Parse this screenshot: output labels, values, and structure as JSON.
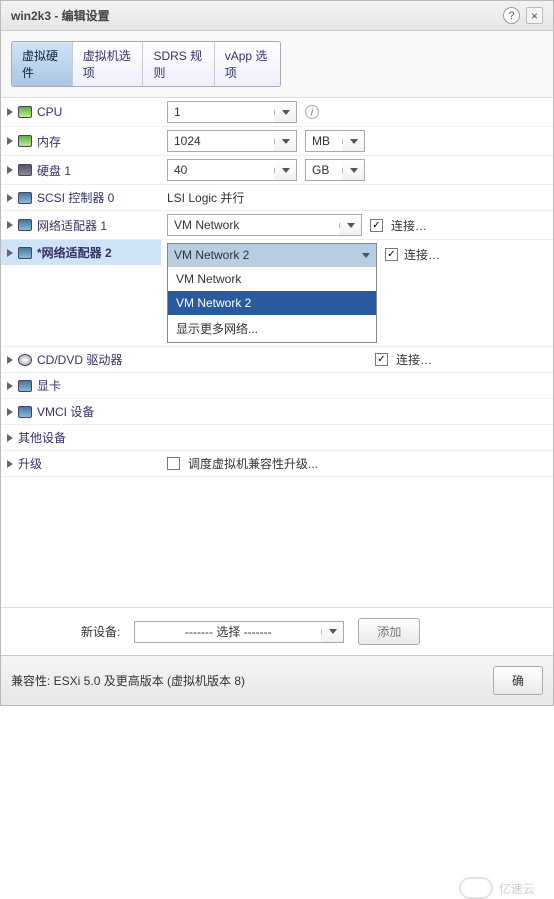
{
  "window": {
    "title": "win2k3 - 编辑设置"
  },
  "tabs": {
    "t0": "虚拟硬件",
    "t1": "虚拟机选项",
    "t2": "SDRS 规则",
    "t3": "vApp 选项"
  },
  "rows": {
    "cpu": {
      "label": "CPU",
      "value": "1"
    },
    "mem": {
      "label": "内存",
      "value": "1024",
      "unit": "MB"
    },
    "hdd": {
      "label": "硬盘 1",
      "value": "40",
      "unit": "GB"
    },
    "scsi": {
      "label": "SCSI 控制器 0",
      "value": "LSI Logic 并行"
    },
    "net1": {
      "label": "网络适配器 1",
      "value": "VM Network",
      "connect": "连接…"
    },
    "net2": {
      "label": "*网络适配器 2",
      "value": "VM Network 2",
      "connect": "连接…",
      "options": {
        "o0": "VM Network",
        "o1": "VM Network 2",
        "o2": "显示更多网络..."
      }
    },
    "cd": {
      "label": "CD/DVD 驱动器",
      "value_hidden": "",
      "connect": "连接…"
    },
    "gpu": {
      "label": "显卡"
    },
    "vmci": {
      "label": "VMCI 设备"
    },
    "other": {
      "label": "其他设备"
    },
    "upgrade": {
      "label": "升级",
      "check_label": "调度虚拟机兼容性升级..."
    }
  },
  "newdev": {
    "label": "新设备:",
    "select": "------- 选择 -------",
    "add": "添加"
  },
  "footer": {
    "compat": "兼容性: ESXi 5.0 及更高版本 (虚拟机版本 8)",
    "ok": "确",
    "cancel": ""
  },
  "watermark": "亿速云",
  "glyph": {
    "check": "✓",
    "info": "i",
    "help": "?",
    "close": "×"
  }
}
